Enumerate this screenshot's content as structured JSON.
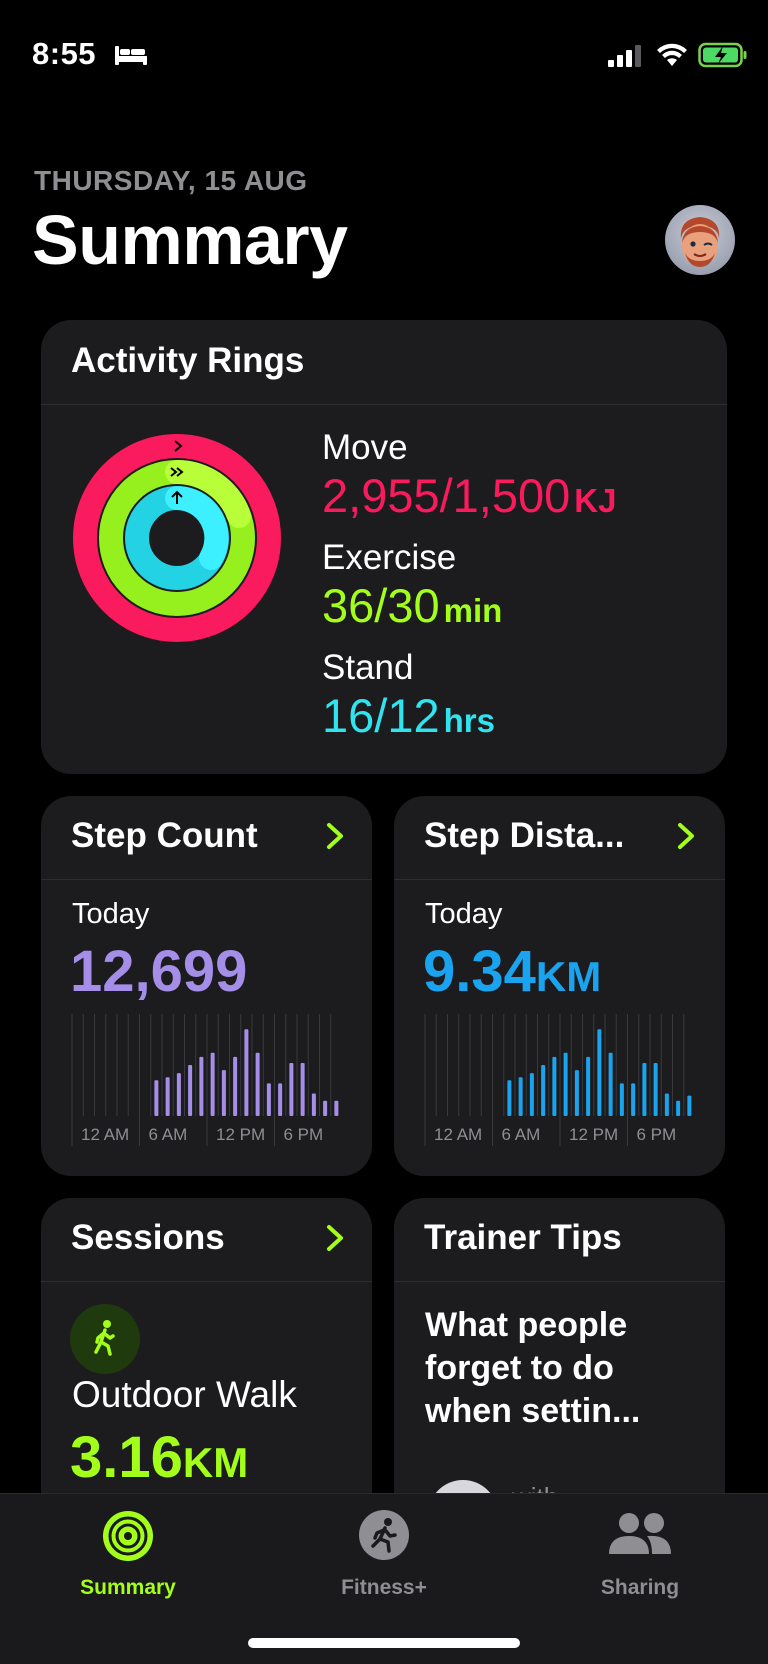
{
  "status_bar": {
    "time": "8:55",
    "sleep_icon": "bed-icon",
    "signal": "cellular-signal-icon",
    "wifi": "wifi-icon",
    "battery": "battery-charging-icon"
  },
  "header": {
    "date": "THURSDAY, 15 AUG",
    "title": "Summary",
    "avatar": "memoji-avatar"
  },
  "activity_rings": {
    "title": "Activity Rings",
    "move": {
      "label": "Move",
      "value": "2,955/1,500",
      "unit": "KJ",
      "progress": 1.97,
      "color": "#fa1a5e"
    },
    "exercise": {
      "label": "Exercise",
      "value": "36/30",
      "unit": "min",
      "progress": 1.2,
      "color": "#a3ff1a"
    },
    "stand": {
      "label": "Stand",
      "value": "16/12",
      "unit": "hrs",
      "progress": 1.33,
      "color": "#2fe4ef"
    }
  },
  "step_count": {
    "title": "Step Count",
    "period": "Today",
    "value": "12,699",
    "color": "#a48ee8",
    "hourly_bars": [
      0,
      0,
      0,
      0,
      0,
      0,
      0,
      0.35,
      0.38,
      0.42,
      0.5,
      0.58,
      0.62,
      0.45,
      0.58,
      0.85,
      0.62,
      0.32,
      0.32,
      0.52,
      0.52,
      0.22,
      0.15,
      0.15
    ],
    "axis_ticks": [
      "12 AM",
      "6 AM",
      "12 PM",
      "6 PM"
    ]
  },
  "step_distance": {
    "title": "Step Dista...",
    "period": "Today",
    "value": "9.34",
    "unit": "KM",
    "color": "#1aa4ef",
    "hourly_bars": [
      0,
      0,
      0,
      0,
      0,
      0,
      0,
      0.35,
      0.38,
      0.42,
      0.5,
      0.58,
      0.62,
      0.45,
      0.58,
      0.85,
      0.62,
      0.32,
      0.32,
      0.52,
      0.52,
      0.22,
      0.15,
      0.2
    ],
    "axis_ticks": [
      "12 AM",
      "6 AM",
      "12 PM",
      "6 PM"
    ]
  },
  "sessions": {
    "title": "Sessions",
    "workout_icon": "walking-figure-icon",
    "workout": "Outdoor Walk",
    "value": "3.16",
    "unit": "KM",
    "color": "#a3ff1a"
  },
  "trainer_tips": {
    "title": "Trainer Tips",
    "headline_lines": [
      "What people",
      "forget to do",
      "when settin..."
    ],
    "byline": "with"
  },
  "tab_bar": {
    "tabs": [
      {
        "label": "Summary",
        "icon": "summary-rings-icon",
        "active": true
      },
      {
        "label": "Fitness+",
        "icon": "fitness-plus-runner-icon",
        "active": false
      },
      {
        "label": "Sharing",
        "icon": "sharing-people-icon",
        "active": false
      }
    ],
    "active_color": "#a3ff1a",
    "inactive_color": "#8e8e93"
  }
}
